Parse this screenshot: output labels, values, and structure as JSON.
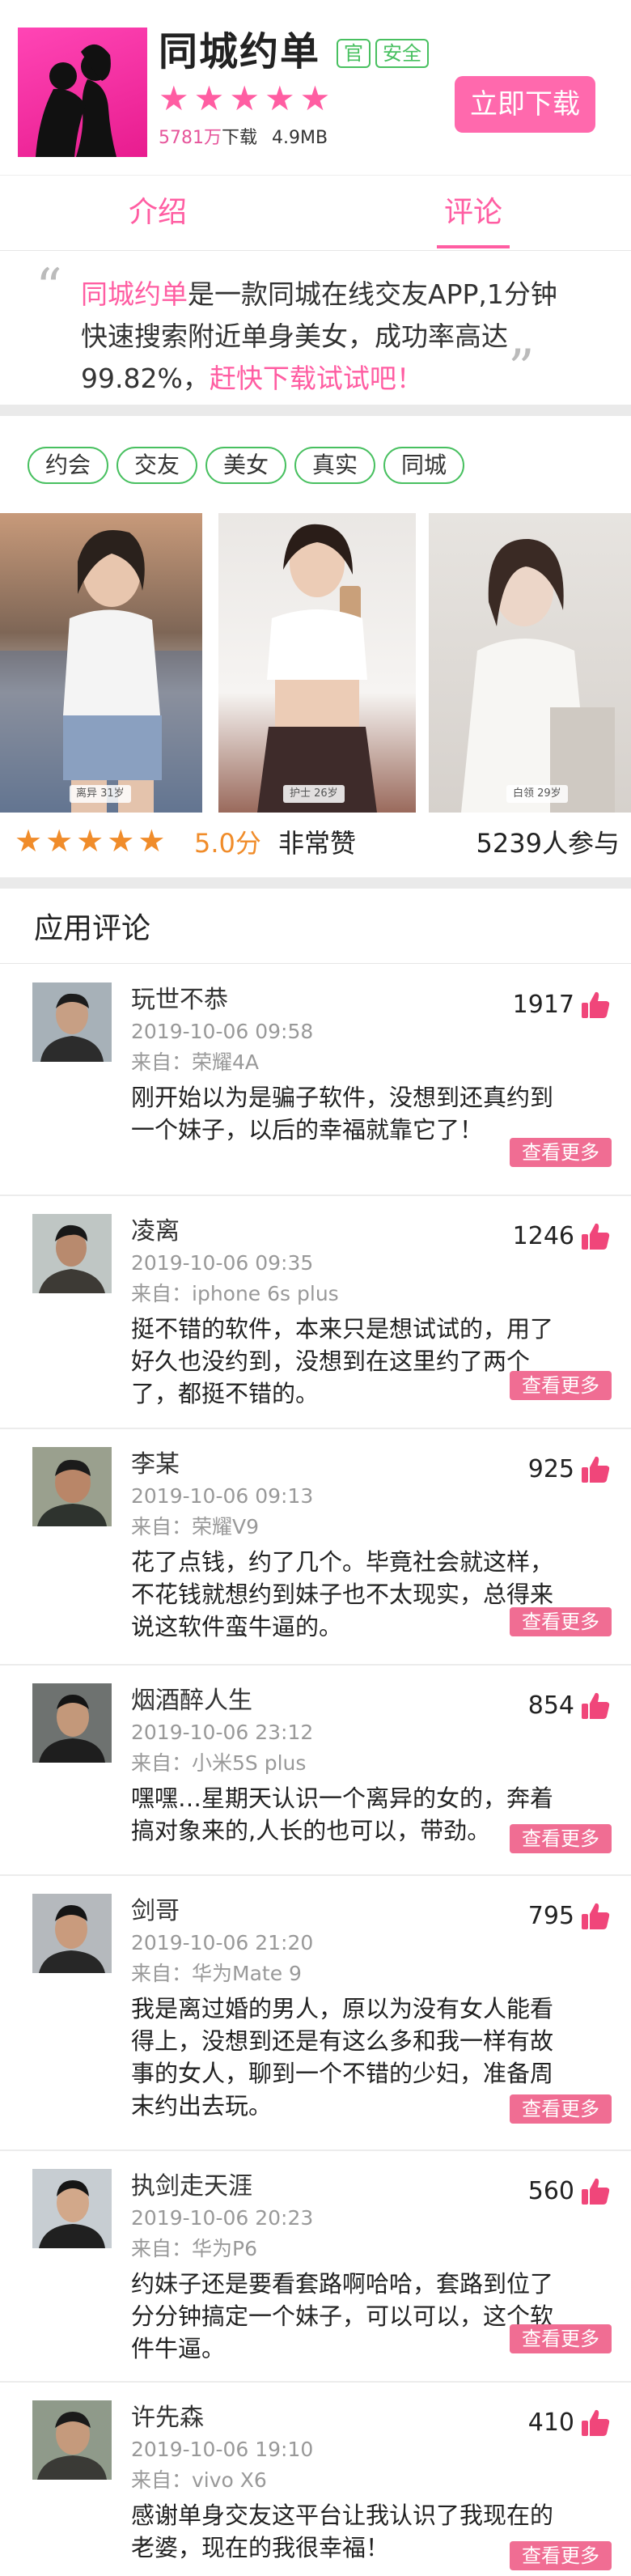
{
  "app": {
    "name": "同城约单",
    "tag_official": "官",
    "tag_safe": "安全",
    "stars": [
      "★",
      "★",
      "★",
      "★",
      "★"
    ],
    "downloads": "5781万",
    "downloads_suffix": "下载",
    "size": "4.9MB",
    "download_label": "立即下载",
    "icon": "couple-silhouette-icon",
    "accent_color": "#ff69ad"
  },
  "tabs": {
    "intro": "介绍",
    "review": "评论",
    "active": "评论"
  },
  "intro": {
    "open_quote": "“",
    "close_quote": "”",
    "highlight_name": "同城约单",
    "text_mid": "是一款同城在线交友APP,1分钟快速搜索附近单身美女，成功率高达99.82%，",
    "highlight_tail": "赶快下载试试吧！"
  },
  "keywords": [
    "约会",
    "交友",
    "美女",
    "真实",
    "同城"
  ],
  "photos": [
    {
      "caption": "离异 31岁"
    },
    {
      "caption": "护士 26岁"
    },
    {
      "caption": "白领 29岁"
    }
  ],
  "rating": {
    "stars": [
      "★",
      "★",
      "★",
      "★",
      "★"
    ],
    "score": "5.0分",
    "word": "非常赞",
    "participants": "5239人参与"
  },
  "reviews_title": "应用评论",
  "more_label": "查看更多",
  "reviews": [
    {
      "name": "玩世不恭",
      "date": "2019-10-06  09:58",
      "device": "来自：荣耀4A",
      "likes": "1917",
      "text": "刚开始以为是骗子软件，没想到还真约到一个妹子，以后的幸福就靠它了！"
    },
    {
      "name": "凌离",
      "date": "2019-10-06  09:35",
      "device": "来自：iphone 6s plus",
      "likes": "1246",
      "text": "挺不错的软件，本来只是想试试的，用了好久也没约到，没想到在这里约了两个了，都挺不错的。"
    },
    {
      "name": "李某",
      "date": "2019-10-06  09:13",
      "device": "来自：荣耀V9",
      "likes": "925",
      "text": "花了点钱，约了几个。毕竟社会就这样，不花钱就想约到妹子也不太现实，总得来说这软件蛮牛逼的。"
    },
    {
      "name": "烟酒醉人生",
      "date": "2019-10-06  23:12",
      "device": "来自：小米5S plus",
      "likes": "854",
      "text": "嘿嘿…星期天认识一个离异的女的，奔着搞对象来的,人长的也可以，带劲。"
    },
    {
      "name": "剑哥",
      "date": "2019-10-06  21:20",
      "device": "来自：华为Mate 9",
      "likes": "795",
      "text": "我是离过婚的男人，原以为没有女人能看得上，没想到还是有这么多和我一样有故事的女人，聊到一个不错的少妇，准备周末约出去玩。"
    },
    {
      "name": "执剑走天涯",
      "date": "2019-10-06  20:23",
      "device": "来自：华为P6",
      "likes": "560",
      "text": "约妹子还是要看套路啊哈哈，套路到位了分分钟搞定一个妹子，可以可以，这个软件牛逼。"
    },
    {
      "name": "许先森",
      "date": "2019-10-06  19:10",
      "device": "来自：vivo X6",
      "likes": "410",
      "text": "感谢单身交友这平台让我认识了我现在的老婆，现在的我很幸福！"
    }
  ]
}
